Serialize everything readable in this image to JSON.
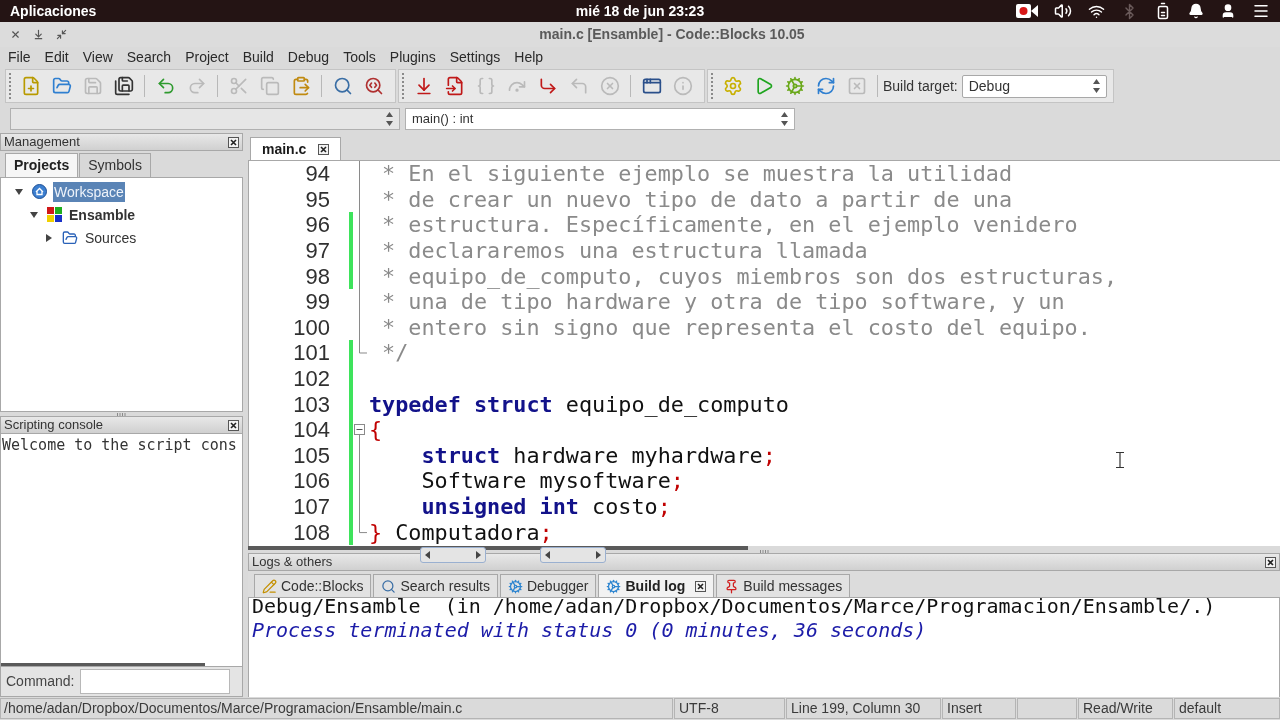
{
  "top_bar": {
    "menu": "Aplicaciones",
    "clock": "mié 18 de jun 23:23"
  },
  "window": {
    "title": "main.c [Ensamble] - Code::Blocks 10.05"
  },
  "menu": [
    "File",
    "Edit",
    "View",
    "Search",
    "Project",
    "Build",
    "Debug",
    "Tools",
    "Plugins",
    "Settings",
    "Help"
  ],
  "toolbars": [
    {
      "groups": [
        [
          {
            "kind": "new",
            "disabled": false
          },
          {
            "kind": "open",
            "disabled": false
          },
          {
            "kind": "save",
            "disabled": true
          },
          {
            "kind": "saveall",
            "disabled": false
          }
        ],
        [
          {
            "kind": "undo",
            "disabled": false
          },
          {
            "kind": "redo",
            "disabled": true
          }
        ],
        [
          {
            "kind": "cut",
            "disabled": true
          },
          {
            "kind": "copy",
            "disabled": true
          },
          {
            "kind": "paste",
            "disabled": false
          }
        ],
        [
          {
            "kind": "find",
            "disabled": false
          },
          {
            "kind": "replace",
            "disabled": false
          }
        ]
      ]
    },
    {
      "groups": [
        [
          {
            "kind": "cursor",
            "disabled": false
          },
          {
            "kind": "stepin",
            "disabled": false
          },
          {
            "kind": "next",
            "disabled": true
          },
          {
            "kind": "nextinstr",
            "disabled": true
          },
          {
            "kind": "stepinto",
            "disabled": false
          },
          {
            "kind": "stepout",
            "disabled": true
          },
          {
            "kind": "stop",
            "disabled": true
          }
        ],
        [
          {
            "kind": "windows",
            "disabled": false
          },
          {
            "kind": "info",
            "disabled": true
          }
        ]
      ]
    },
    {
      "groups": [
        [
          {
            "kind": "build",
            "disabled": false
          },
          {
            "kind": "run",
            "disabled": false
          },
          {
            "kind": "buildrun",
            "disabled": false
          },
          {
            "kind": "rebuild",
            "disabled": false
          },
          {
            "kind": "abort",
            "disabled": true
          }
        ]
      ],
      "target_label": "Build target:",
      "target": "Debug"
    }
  ],
  "code_selectors": {
    "function": "main() : int"
  },
  "management": {
    "title": "Management",
    "tabs": [
      {
        "label": "Projects",
        "selected": true
      },
      {
        "label": "Symbols",
        "selected": false
      }
    ],
    "tree": [
      {
        "label": "Workspace",
        "kind": "workspace",
        "selected": true,
        "active": false,
        "expanded": true,
        "children": [
          {
            "label": "Ensamble",
            "kind": "project",
            "selected": false,
            "active": true,
            "expanded": true,
            "children": [
              {
                "label": "Sources",
                "kind": "folder",
                "selected": false,
                "active": false,
                "expanded": false
              }
            ]
          }
        ]
      }
    ]
  },
  "scripting_console": {
    "title": "Scripting console",
    "output": "Welcome to the script cons",
    "command_label": "Command:"
  },
  "editor": {
    "tabs": [
      {
        "label": "main.c",
        "selected": true
      }
    ],
    "lines": [
      {
        "number": "94",
        "changed": false,
        "kind": "guide",
        "segments": [
          {
            "kind": "comment",
            "text": " * En el siguiente ejemplo se muestra la utilidad"
          }
        ]
      },
      {
        "number": "95",
        "changed": false,
        "kind": "guide",
        "segments": [
          {
            "kind": "comment",
            "text": " * de crear un nuevo tipo de dato a partir de una"
          }
        ]
      },
      {
        "number": "96",
        "changed": true,
        "kind": "guide",
        "segments": [
          {
            "kind": "comment",
            "text": " * estructura. Específicamente, en el ejemplo venidero"
          }
        ]
      },
      {
        "number": "97",
        "changed": true,
        "kind": "guide",
        "segments": [
          {
            "kind": "comment",
            "text": " * declararemos una estructura llamada"
          }
        ]
      },
      {
        "number": "98",
        "changed": true,
        "kind": "guide",
        "segments": [
          {
            "kind": "comment",
            "text": " * equipo_de_computo, cuyos miembros son dos estructuras,"
          }
        ]
      },
      {
        "number": "99",
        "changed": false,
        "kind": "guide",
        "segments": [
          {
            "kind": "comment",
            "text": " * una de tipo hardware y otra de tipo software, y un"
          }
        ]
      },
      {
        "number": "100",
        "changed": false,
        "kind": "guide",
        "segments": [
          {
            "kind": "comment",
            "text": " * entero sin signo que representa el costo del equipo."
          }
        ]
      },
      {
        "number": "101",
        "changed": true,
        "kind": "corner",
        "segments": [
          {
            "kind": "comment",
            "text": " */"
          }
        ]
      },
      {
        "number": "102",
        "changed": true,
        "kind": "plain"
      },
      {
        "number": "103",
        "changed": true,
        "kind": "plain",
        "segments": [
          {
            "kind": "keyword",
            "text": "typedef"
          },
          {
            "kind": "keyword",
            "text": " struct"
          },
          {
            "kind": "plain",
            "text": " equipo_de_computo"
          }
        ]
      },
      {
        "number": "104",
        "changed": true,
        "kind": "box",
        "segments": [
          {
            "kind": "punct",
            "text": "{"
          }
        ]
      },
      {
        "number": "105",
        "changed": true,
        "kind": "guide",
        "segments": [
          {
            "kind": "keyword",
            "text": "    struct"
          },
          {
            "kind": "plain",
            "text": " hardware myhardware"
          },
          {
            "kind": "punct",
            "text": ";"
          }
        ]
      },
      {
        "number": "106",
        "changed": true,
        "kind": "guide",
        "segments": [
          {
            "kind": "plain",
            "text": "    Software mysoftware"
          },
          {
            "kind": "punct",
            "text": ";"
          }
        ]
      },
      {
        "number": "107",
        "changed": true,
        "kind": "guide",
        "segments": [
          {
            "kind": "keyword",
            "text": "    unsigned"
          },
          {
            "kind": "keyword",
            "text": " int"
          },
          {
            "kind": "plain",
            "text": " costo"
          },
          {
            "kind": "punct",
            "text": ";"
          }
        ]
      },
      {
        "number": "108",
        "changed": true,
        "kind": "corner",
        "segments": [
          {
            "kind": "punct",
            "text": "}"
          },
          {
            "kind": "plain",
            "text": " Computadora"
          },
          {
            "kind": "punct",
            "text": ";"
          }
        ]
      }
    ]
  },
  "logs": {
    "title": "Logs & others",
    "tabs": [
      {
        "label": "Code::Blocks",
        "kind": "pencil",
        "selected": false
      },
      {
        "label": "Search results",
        "kind": "search",
        "selected": false
      },
      {
        "label": "Debugger",
        "kind": "cog",
        "selected": false
      },
      {
        "label": "Build log",
        "kind": "cog",
        "selected": true
      },
      {
        "label": "Build messages",
        "kind": "pin",
        "selected": false
      }
    ],
    "lines": [
      {
        "kind": "normal",
        "text": "Debug/Ensamble  (in /home/adan/Dropbox/Documentos/Marce/Programacion/Ensamble/.)"
      },
      {
        "kind": "status",
        "text": "Process terminated with status 0 (0 minutes, 36 seconds)"
      }
    ]
  },
  "status_bar": {
    "path": "/home/adan/Dropbox/Documentos/Marce/Programacion/Ensamble/main.c",
    "encoding": "UTF-8",
    "position": "Line 199, Column 30",
    "mode": "Insert",
    "access": "Read/Write",
    "profile": "default"
  }
}
